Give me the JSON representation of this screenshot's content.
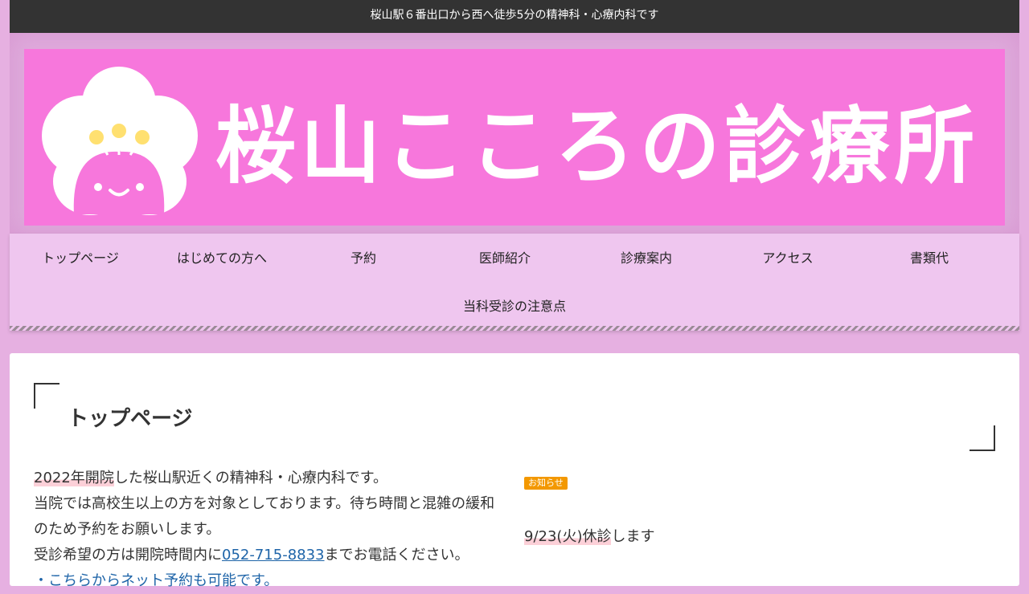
{
  "topbar": {
    "text": "桜山駅６番出口から西へ徒歩5分の精神科・心療内科です"
  },
  "header": {
    "logo_text": "桜山こころの診療所",
    "colors": {
      "banner_bg": "#f777dc",
      "logo_fg": "#ffffff",
      "bud": "#ffe070"
    }
  },
  "nav": {
    "items": [
      {
        "label": "トップページ"
      },
      {
        "label": "はじめての方へ"
      },
      {
        "label": "予約"
      },
      {
        "label": "医師紹介"
      },
      {
        "label": "診療案内"
      },
      {
        "label": "アクセス"
      },
      {
        "label": "書類代"
      },
      {
        "label": "当科受診の注意点"
      }
    ]
  },
  "main": {
    "title": "トップページ",
    "intro": {
      "line1_highlight": "2022年開院",
      "line1_rest": "した桜山駅近くの精神科・心療内科です。",
      "line2": "当院では高校生以上の方を対象としております。待ち時間と混雑の緩和",
      "line3": "のため予約をお願いします。",
      "line4_pre": "受診希望の方は開院時間内に",
      "phone": "052-715-8833",
      "line4_post": "までお電話ください。",
      "line5": "・こちらからネット予約も可能です。"
    },
    "news": {
      "badge": "お知らせ",
      "item_highlight": "9/23(火)休診",
      "item_rest": "します"
    }
  }
}
